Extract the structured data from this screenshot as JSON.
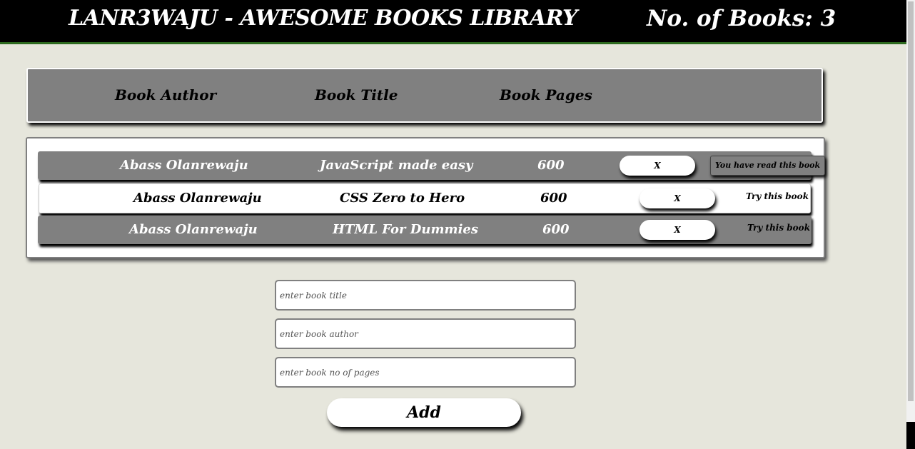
{
  "header": {
    "title": "LANR3WAJU - AWESOME BOOKS LIBRARY",
    "book_count": "No. of Books: 3"
  },
  "columns": {
    "author": "Book Author",
    "title": "Book Title",
    "pages": "Book Pages"
  },
  "books": [
    {
      "author": "Abass Olanrewaju",
      "title": "JavaScript made easy",
      "pages": "600",
      "remove_label": "X",
      "status": "You have read this book"
    },
    {
      "author": "Abass Olanrewaju",
      "title": "CSS Zero to Hero",
      "pages": "600",
      "remove_label": "X",
      "status": "Try this book"
    },
    {
      "author": "Abass Olanrewaju",
      "title": "HTML For Dummies",
      "pages": "600",
      "remove_label": "X",
      "status": "Try this book"
    }
  ],
  "form": {
    "title_placeholder": "enter book title",
    "title_value": "",
    "author_placeholder": "enter book author",
    "author_value": "",
    "pages_placeholder": "enter book no of pages",
    "pages_value": "",
    "add_label": "Add"
  },
  "colors": {
    "header_bg": "#000000",
    "header_border": "#2d6a1f",
    "page_bg": "#e6e6dc",
    "row_grey": "#808080"
  }
}
